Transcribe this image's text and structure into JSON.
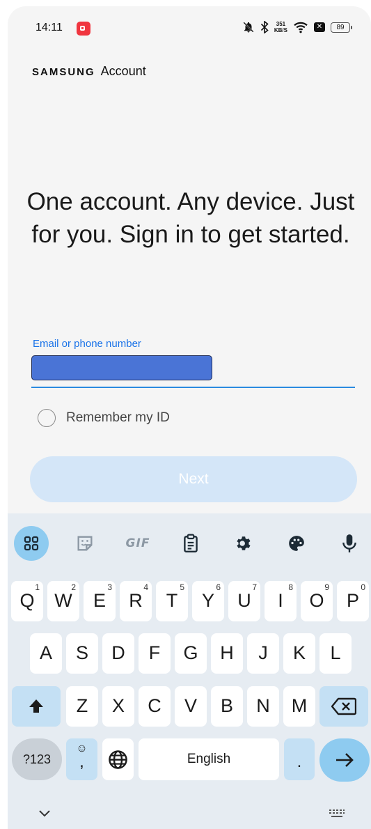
{
  "status_bar": {
    "time": "14:11",
    "speed_top": "351",
    "speed_bottom": "KB/S",
    "battery": "89",
    "icons": [
      "screen-record-icon",
      "mute-icon",
      "bluetooth-icon",
      "wifi-icon",
      "x-icon",
      "battery-icon"
    ]
  },
  "brand": {
    "logo": "SAMSUNG",
    "account": "Account"
  },
  "headline": "One account. Any device. Just for you. Sign in to get started.",
  "form": {
    "email_label": "Email or phone number",
    "email_value": "",
    "remember_label": "Remember my ID",
    "remember_checked": false,
    "next_label": "Next"
  },
  "keyboard": {
    "toolbar": [
      "apps-icon",
      "sticker-icon",
      "gif-icon",
      "clipboard-icon",
      "settings-icon",
      "palette-icon",
      "mic-icon"
    ],
    "gif_label": "GIF",
    "row1": [
      {
        "k": "Q",
        "s": "1"
      },
      {
        "k": "W",
        "s": "2"
      },
      {
        "k": "E",
        "s": "3"
      },
      {
        "k": "R",
        "s": "4"
      },
      {
        "k": "T",
        "s": "5"
      },
      {
        "k": "Y",
        "s": "6"
      },
      {
        "k": "U",
        "s": "7"
      },
      {
        "k": "I",
        "s": "8"
      },
      {
        "k": "O",
        "s": "9"
      },
      {
        "k": "P",
        "s": "0"
      }
    ],
    "row2": [
      "A",
      "S",
      "D",
      "F",
      "G",
      "H",
      "J",
      "K",
      "L"
    ],
    "row3": [
      "Z",
      "X",
      "C",
      "V",
      "B",
      "N",
      "M"
    ],
    "symbols_label": "?123",
    "comma_label": ",",
    "space_label": "English",
    "period_label": "."
  },
  "colors": {
    "accent": "#1a73e8",
    "next_bg": "#d4e6f8",
    "key_accent": "#8ecbf0"
  }
}
